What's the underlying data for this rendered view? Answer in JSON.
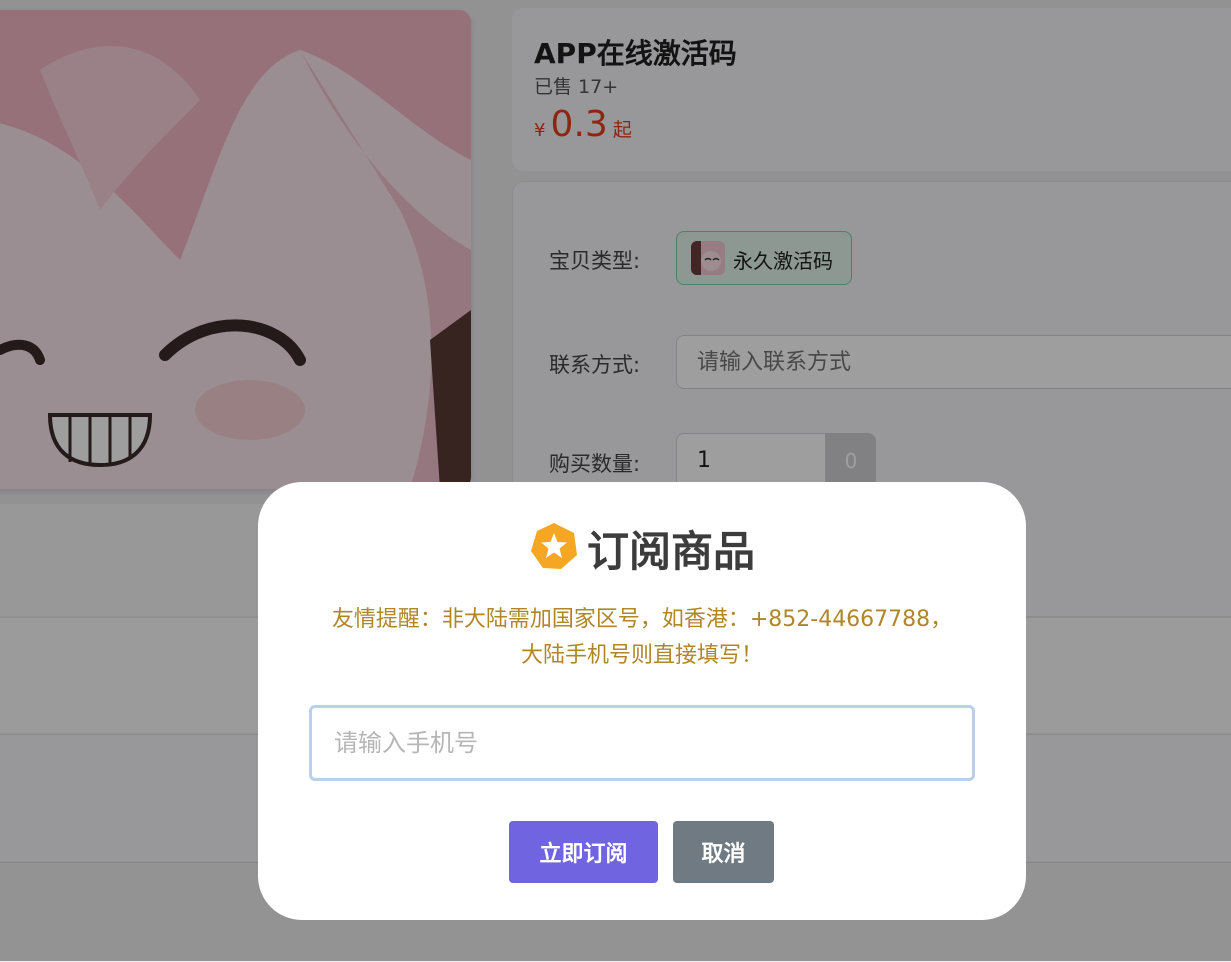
{
  "product": {
    "title": "APP在线激活码",
    "sold": "已售 17+",
    "price_currency": "¥",
    "price_value": "0.3",
    "price_suffix": "起"
  },
  "options": {
    "type_label": "宝贝类型:",
    "type_chip_label": "永久激活码",
    "contact_label": "联系方式:",
    "contact_placeholder": "请输入联系方式",
    "quantity_label": "购买数量:",
    "quantity_value": "1",
    "quantity_addon": "0"
  },
  "modal": {
    "icon": "star-badge-icon",
    "title": "订阅商品",
    "notice_line1": "友情提醒：非大陆需加国家区号，如香港：+852-44667788，",
    "notice_line2": "大陆手机号则直接填写！",
    "phone_placeholder": "请输入手机号",
    "subscribe_label": "立即订阅",
    "cancel_label": "取消"
  },
  "colors": {
    "price": "#e0401c",
    "notice": "#b08628",
    "primary_button": "#7164e0",
    "secondary_button": "#6f7a83",
    "icon_orange": "#f5a623"
  }
}
